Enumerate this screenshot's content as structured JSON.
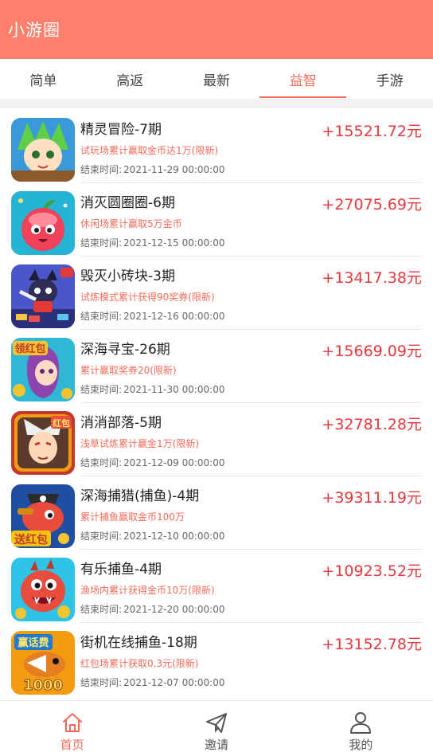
{
  "header": {
    "title": "小游圈"
  },
  "tabs": [
    {
      "label": "简单",
      "active": false
    },
    {
      "label": "高返",
      "active": false
    },
    {
      "label": "最新",
      "active": false
    },
    {
      "label": "益智",
      "active": true
    },
    {
      "label": "手游",
      "active": false
    }
  ],
  "time_label": "结束时间:",
  "items": [
    {
      "title": "精灵冒险-7期",
      "desc": "试玩场累计赢取金币达1万(限新)",
      "end_time": "2021-11-29 00:00:00",
      "amount": "+15521.72元"
    },
    {
      "title": "消灭圆圈圈-6期",
      "desc": "休闲场累计赢取5万金币",
      "end_time": "2021-12-15 00:00:00",
      "amount": "+27075.69元"
    },
    {
      "title": "毁灭小砖块-3期",
      "desc": "试炼模式累计获得90奖券(限新)",
      "end_time": "2021-12-16 00:00:00",
      "amount": "+13417.38元"
    },
    {
      "title": "深海寻宝-26期",
      "desc": "累计赢取奖券20(限新)",
      "end_time": "2021-11-30 00:00:00",
      "amount": "+15669.09元"
    },
    {
      "title": "消消部落-5期",
      "desc": "浅草试炼累计赢金1万(限新)",
      "end_time": "2021-12-09 00:00:00",
      "amount": "+32781.28元"
    },
    {
      "title": "深海捕猎(捕鱼)-4期",
      "desc": "累计捕鱼赢取金币100万",
      "end_time": "2021-12-10 00:00:00",
      "amount": "+39311.19元"
    },
    {
      "title": "有乐捕鱼-4期",
      "desc": "渔场内累计获得金币10万(限新)",
      "end_time": "2021-12-20 00:00:00",
      "amount": "+10923.52元"
    },
    {
      "title": "街机在线捕鱼-18期",
      "desc": "红包场累计获取0.3元(限新)",
      "end_time": "2021-12-07 00:00:00",
      "amount": "+13152.78元"
    }
  ],
  "thumb_labels": {
    "item3": "领红包",
    "item4": "红包",
    "item5": "送红包",
    "item7_top": "赢话费",
    "item7_bottom": "1000"
  },
  "bottom_nav": [
    {
      "label": "首页",
      "icon": "home-icon",
      "active": true
    },
    {
      "label": "邀请",
      "icon": "paper-plane-icon",
      "active": false
    },
    {
      "label": "我的",
      "icon": "user-icon",
      "active": false
    }
  ],
  "colors": {
    "header_bg": "#ff7f6d",
    "accent": "#f26b59",
    "amount": "#e8383d"
  }
}
